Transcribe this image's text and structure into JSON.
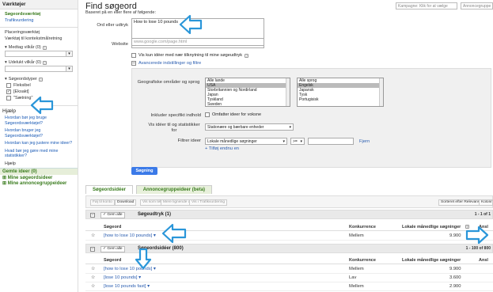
{
  "sidebar": {
    "tools_header": "Værktøjer",
    "tools": [
      {
        "label": "Søgeordsværktøj",
        "active": true
      },
      {
        "label": "Trafikvurdering",
        "active": false
      }
    ],
    "placement_tool": "Placeringsværktøj",
    "context_tool": "Værktøj til kontekstmålretning",
    "include_terms": "Medtag vilkår (0)",
    "exclude_terms": "Udelukt vilkår (0)",
    "match_types_label": "Søgeordstyper",
    "match_types": [
      {
        "label": "Fleksibel",
        "checked": false
      },
      {
        "label": "[Eksakt]",
        "checked": true
      },
      {
        "label": "\"Sætning\"",
        "checked": false
      }
    ],
    "help_header": "Hjælp",
    "help_links": [
      "Hvordan bør jeg bruge Søgeordsværktøjet?",
      "Hvordan bruger jeg Søgeordsværktøjet?",
      "Hvordan kan jeg justere mine ideer?",
      "Hvad bør jeg gøre med mine statistikker?"
    ],
    "help_link": "Hjælp",
    "saved_ideas_header": "Gemte ideer (0)",
    "saved_links": [
      "Mine søgeordsideer",
      "Mine annoncegruppeideer"
    ]
  },
  "header": {
    "title": "Find søgeord",
    "subtitle": "Baseret på en eller flere af følgende:",
    "campaign_placeholder": "Kampagne: Klik for at vælge",
    "adgroup_placeholder": "Annoncegruppe"
  },
  "form": {
    "word_label": "Ord eller udtryk",
    "word_value": "How to lose 10 pounds",
    "website_label": "Website",
    "website_placeholder": "www.google.com/page.html",
    "only_close_label": "Vis kun idéer med nær tilknytning til mine søgeudtryk",
    "advanced_link": "Avancerede indstillinger og filtre",
    "geo_label": "Geografiske områder og sprog",
    "locations": [
      "Alle lande",
      "USA",
      "Storbritannien og Nordirland",
      "Japan",
      "Tyskland",
      "Sweden"
    ],
    "locations_selected": 1,
    "languages": [
      "Alle sprog",
      "Engelsk",
      "Japansk",
      "Tysk",
      "Portugisisk"
    ],
    "languages_selected": 1,
    "include_label": "Inkluder specifikt indhold",
    "include_option": "Omfatter ideer for voksne",
    "show_ideas_label": "Vis idéer til og statistikker for",
    "device_value": "Stationære og bærbare enheder",
    "filter_label": "Filtrer ideer",
    "filter_metric": "Lokale månedlige søgninger",
    "filter_op": ">=",
    "remove_link": "Fjern",
    "add_link": "+ Tilføj endnu en",
    "search_button": "Søgning"
  },
  "tabs": [
    "Søgeordsidéer",
    "Annoncegruppeideer (beta)"
  ],
  "toolbar": {
    "add_label": "Føj til konto",
    "download_label": "Download",
    "view_text_label": "Vis som tekst",
    "more_like_label": "Mere lignende disse",
    "traffic_label": "Vis i Trafikvurdering",
    "sort_label": "Sorteret efter Relevans",
    "columns_label": "Kolonner"
  },
  "groups": [
    {
      "save_label": "Gem alle",
      "title": "Søgeudtryk (1)",
      "range": "1 - 1 of 1"
    },
    {
      "save_label": "Gem alle",
      "title": "Søgeordsidéer (800)",
      "range": "1 - 100 of 800"
    }
  ],
  "columns": {
    "keyword": "Søgeord",
    "competition": "Konkurrence",
    "local_monthly": "Lokale månedlige søgninger",
    "global_monthly": "Ansl"
  },
  "search_terms": [
    {
      "keyword": "[how to lose 10 pounds]",
      "competition": "Mellem",
      "local": "9.900"
    }
  ],
  "keyword_ideas": [
    {
      "keyword": "[how to lose 10 pounds]",
      "competition": "Mellem",
      "local": "9.900"
    },
    {
      "keyword": "[lose 10 pounds]",
      "competition": "Lav",
      "local": "3.600"
    },
    {
      "keyword": "[lose 10 pounds fast]",
      "competition": "Mellem",
      "local": "2.900"
    }
  ],
  "colors": {
    "annotation_arrow": "#2a96d9",
    "link": "#2a5db0",
    "primary_button": "#3b7ae8",
    "green_header": "#3a7c1e"
  }
}
